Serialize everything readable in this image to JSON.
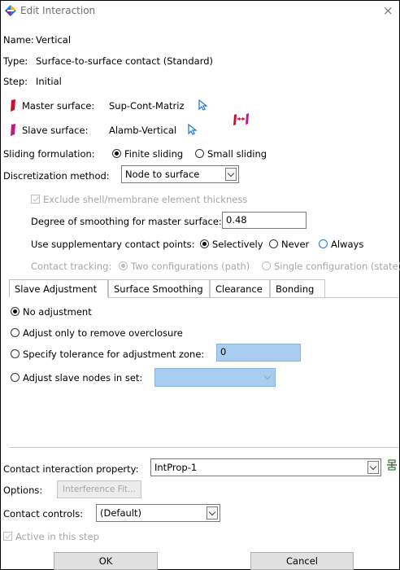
{
  "window": {
    "title": "Edit Interaction"
  },
  "info": {
    "name_label": "Name:",
    "name_value": "Vertical",
    "type_label": "Type:",
    "type_value": "Surface-to-surface contact (Standard)",
    "step_label": "Step:",
    "step_value": "Initial"
  },
  "surfaces": {
    "master_label": "Master surface:",
    "master_value": "Sup-Cont-Matriz",
    "slave_label": "Slave surface:",
    "slave_value": "Alamb-Vertical",
    "master_color": "#c8102e",
    "slave_color": "#c2188c"
  },
  "sliding": {
    "label": "Sliding formulation:",
    "finite": "Finite sliding",
    "small": "Small sliding",
    "selected": "finite"
  },
  "discretization": {
    "label": "Discretization method:",
    "value": "Node to surface"
  },
  "exclude_shell": {
    "label": "Exclude shell/membrane element thickness",
    "checked": true,
    "enabled": false
  },
  "smoothing": {
    "label": "Degree of smoothing for master surface:",
    "value": "0.48"
  },
  "supplementary": {
    "label": "Use supplementary contact points:",
    "options": [
      "Selectively",
      "Never",
      "Always"
    ],
    "selected": "Selectively"
  },
  "tracking": {
    "label": "Contact tracking:",
    "options": [
      "Two configurations (path)",
      "Single configuration (state)"
    ],
    "selected": 0,
    "enabled": false
  },
  "tabs": [
    {
      "label": "Slave Adjustment",
      "active": true
    },
    {
      "label": "Surface Smoothing",
      "active": false
    },
    {
      "label": "Clearance",
      "active": false
    },
    {
      "label": "Bonding",
      "active": false
    }
  ],
  "adjustment": {
    "options": [
      "No adjustment",
      "Adjust only to remove overclosure",
      "Specify tolerance for adjustment zone:",
      "Adjust slave nodes in set:"
    ],
    "selected": 0,
    "tolerance_value": "0",
    "nodeset_value": ""
  },
  "property": {
    "label": "Contact interaction property:",
    "value": "IntProp-1"
  },
  "options": {
    "label": "Options:",
    "button": "Interference Fit..."
  },
  "controls": {
    "label": "Contact controls:",
    "value": "(Default)"
  },
  "active": {
    "label": "Active in this step",
    "checked": true,
    "enabled": false
  },
  "buttons": {
    "ok": "OK",
    "cancel": "Cancel"
  }
}
